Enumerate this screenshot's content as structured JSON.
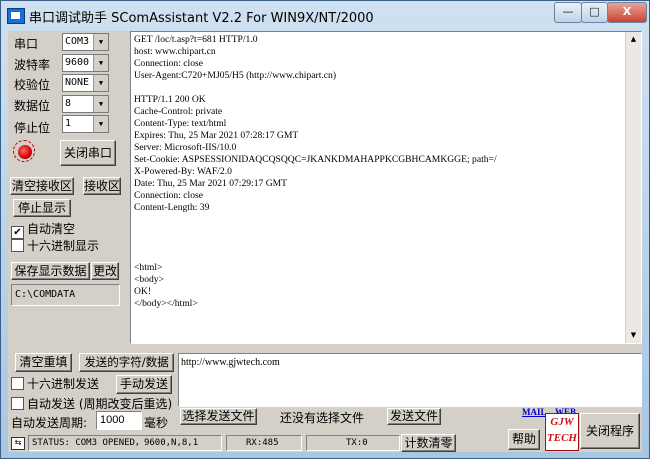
{
  "title": "串口调试助手 SComAssistant V2.2 For WIN9X/NT/2000",
  "window": {
    "minimize": "—",
    "maximize": "□",
    "close": "X"
  },
  "settings": {
    "port_label": "串口",
    "port_value": "COM3",
    "baud_label": "波特率",
    "baud_value": "9600",
    "parity_label": "校验位",
    "parity_value": "NONE",
    "databits_label": "数据位",
    "databits_value": "8",
    "stopbits_label": "停止位",
    "stopbits_value": "1",
    "close_port_btn": "关闭串口"
  },
  "receive": {
    "clear_btn": "清空接收区",
    "area_label": "接收区",
    "stop_display_btn": "停止显示",
    "auto_clear_label": "自动清空",
    "auto_clear_checked": true,
    "hex_display_label": "十六进制显示",
    "hex_display_checked": false,
    "save_btn": "保存显示数据",
    "change_btn": "更改",
    "save_path": "C:\\COMDATA",
    "text": "GET /loc/t.asp?t=681 HTTP/1.0\nhost: www.chipart.cn\nConnection: close\nUser-Agent:C720+MJ05/H5 (http://www.chipart.cn)\n\nHTTP/1.1 200 OK\nCache-Control: private\nContent-Type: text/html\nExpires: Thu, 25 Mar 2021 07:28:17 GMT\nServer: Microsoft-IIS/10.0\nSet-Cookie: ASPSESSIONIDAQCQSQQC=JKANKDMAHAPPKCGBHCAMKGGE; path=/\nX-Powered-By: WAF/2.0\nDate: Thu, 25 Mar 2021 07:29:17 GMT\nConnection: close\nContent-Length: 39\n\n\n\n\n<html>\n<body>\nOK!\n</body></html>"
  },
  "send": {
    "clear_resend_btn": "清空重填",
    "sent_chars_btn": "发送的字符/数据",
    "hex_send_label": "十六进制发送",
    "hex_send_checked": false,
    "manual_send_btn": "手动发送",
    "auto_send_label": "自动发送 (周期改变后重选)",
    "auto_send_checked": false,
    "period_label": "自动发送周期:",
    "period_value": "1000",
    "period_unit": "毫秒",
    "input_text": "http://www.gjwtech.com",
    "select_file_btn": "选择发送文件",
    "no_file_label": "还没有选择文件",
    "send_file_btn": "发送文件"
  },
  "links": {
    "mail": "MAIL",
    "web": "WEB"
  },
  "logo": {
    "line1": "GJW",
    "line2": "TECH"
  },
  "help_btn": "帮助",
  "close_program_btn": "关闭程序",
  "status": {
    "text": "STATUS: COM3 OPENED，9600,N,8,1",
    "rx": "RX:485",
    "tx": "TX:0",
    "reset_btn": "计数清零"
  }
}
